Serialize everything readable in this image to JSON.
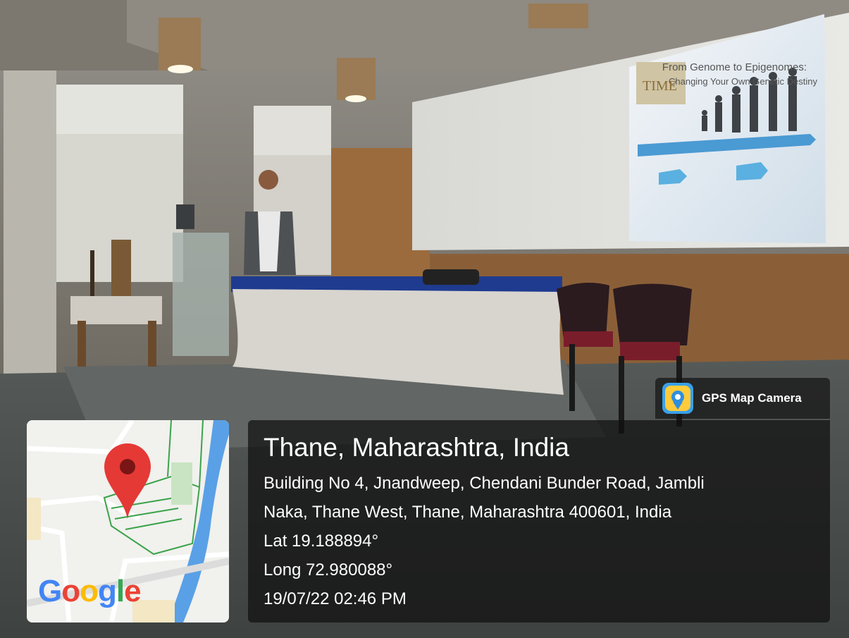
{
  "badge": {
    "label": "GPS Map Camera",
    "icon": "camera-pin-icon"
  },
  "map": {
    "brand": "Google",
    "pin_icon": "map-pin-icon",
    "colors": {
      "pin": "#e53935",
      "river": "#5aa0e6",
      "roads": "#3aa34a"
    }
  },
  "location": {
    "city": "Thane, Maharashtra, India",
    "address_line1": "Building No 4, Jnandweep, Chendani Bunder Road, Jambli",
    "address_line2": "Naka, Thane West, Thane, Maharashtra 400601, India",
    "lat": "Lat 19.188894°",
    "long": "Long 72.980088°",
    "datetime": "19/07/22 02:46 PM"
  },
  "slide": {
    "title_line1": "From Genome to Epigenomes:",
    "title_line2": "Changing Your Own Genetic Destiny",
    "logo": "TIME"
  }
}
